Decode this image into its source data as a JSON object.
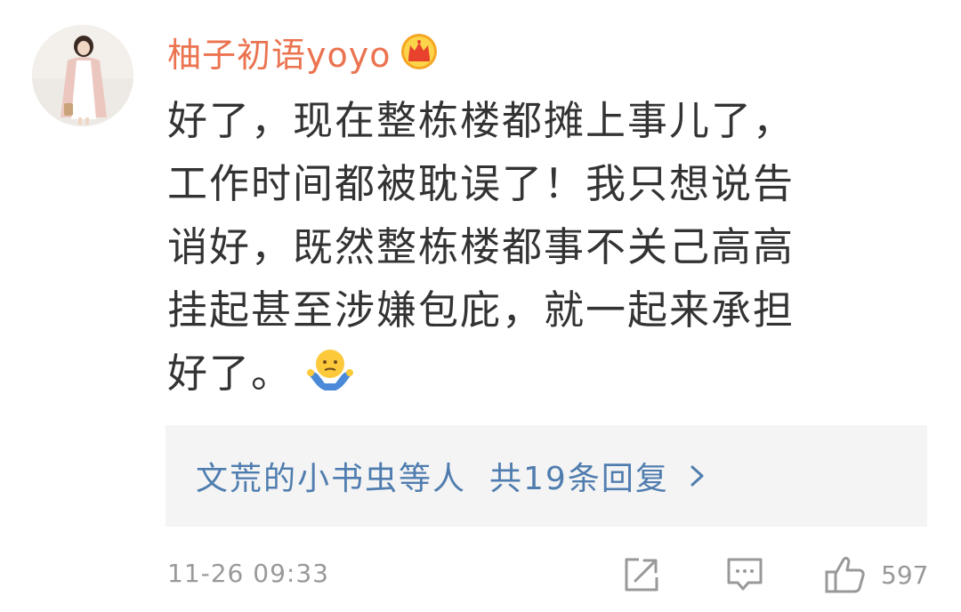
{
  "comment": {
    "username": "柚子初语yoyo",
    "badge_icon": "crown-vip-icon",
    "text_lines": [
      "好了，现在整栋楼都摊上事儿了，",
      "工作时间都被耽误了！我只想说告",
      "诮好，既然整栋楼都事不关己高高",
      "挂起甚至涉嫌包庇，就一起来承担",
      "好了。"
    ],
    "emoji_icon": "shrug-emoji-icon",
    "replies": {
      "names": "文荒的小书虫等人",
      "count_label": "共19条回复",
      "chevron": ">"
    },
    "timestamp": "11-26 09:33",
    "like_count": "597"
  },
  "colors": {
    "username": "#eb7350",
    "text": "#333333",
    "link": "#507daf",
    "reply_bg": "#f4f4f4",
    "meta": "#999999"
  }
}
